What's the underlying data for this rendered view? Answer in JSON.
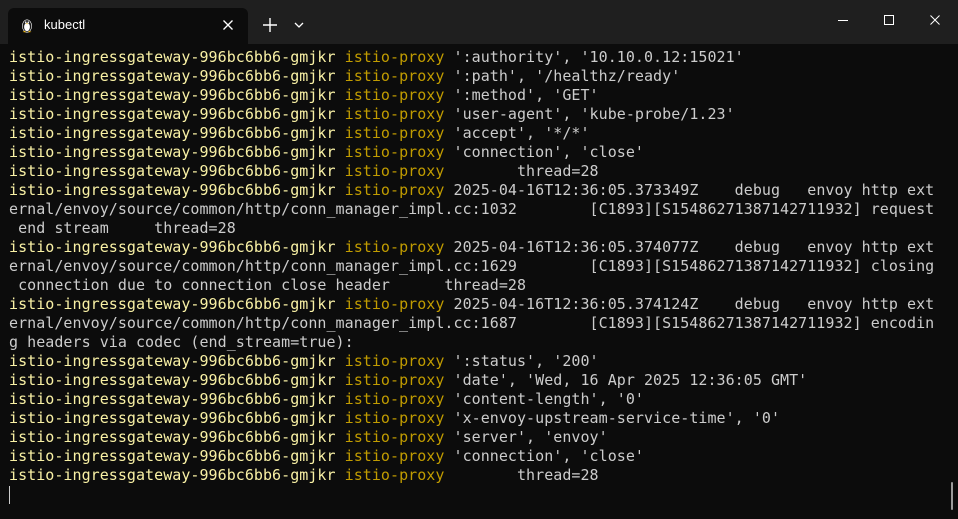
{
  "window": {
    "tab_title": "kubectl",
    "tab_icon": "linux-penguin-icon"
  },
  "colors": {
    "pod_name": "#f9f1a5",
    "container_name": "#c19c00",
    "message": "#cccccc",
    "background": "#0c0c0c",
    "titlebar": "#1f1f1f"
  },
  "terminal": {
    "lines": [
      {
        "pod": "istio-ingressgateway-996bc6bb6-gmjkr",
        "container": "istio-proxy",
        "msg": " ':authority', '10.10.0.12:15021'"
      },
      {
        "pod": "istio-ingressgateway-996bc6bb6-gmjkr",
        "container": "istio-proxy",
        "msg": " ':path', '/healthz/ready'"
      },
      {
        "pod": "istio-ingressgateway-996bc6bb6-gmjkr",
        "container": "istio-proxy",
        "msg": " ':method', 'GET'"
      },
      {
        "pod": "istio-ingressgateway-996bc6bb6-gmjkr",
        "container": "istio-proxy",
        "msg": " 'user-agent', 'kube-probe/1.23'"
      },
      {
        "pod": "istio-ingressgateway-996bc6bb6-gmjkr",
        "container": "istio-proxy",
        "msg": " 'accept', '*/*'"
      },
      {
        "pod": "istio-ingressgateway-996bc6bb6-gmjkr",
        "container": "istio-proxy",
        "msg": " 'connection', 'close'"
      },
      {
        "pod": "istio-ingressgateway-996bc6bb6-gmjkr",
        "container": "istio-proxy",
        "msg": "        thread=28"
      },
      {
        "pod": "istio-ingressgateway-996bc6bb6-gmjkr",
        "container": "istio-proxy",
        "msg": " 2025-04-16T12:36:05.373349Z    debug   envoy http ext"
      },
      {
        "pod": "",
        "container": "",
        "msg": "ernal/envoy/source/common/http/conn_manager_impl.cc:1032        [C1893][S15486271387142711932] request"
      },
      {
        "pod": "",
        "container": "",
        "msg": " end stream     thread=28"
      },
      {
        "pod": "istio-ingressgateway-996bc6bb6-gmjkr",
        "container": "istio-proxy",
        "msg": " 2025-04-16T12:36:05.374077Z    debug   envoy http ext"
      },
      {
        "pod": "",
        "container": "",
        "msg": "ernal/envoy/source/common/http/conn_manager_impl.cc:1629        [C1893][S15486271387142711932] closing"
      },
      {
        "pod": "",
        "container": "",
        "msg": " connection due to connection close header      thread=28"
      },
      {
        "pod": "istio-ingressgateway-996bc6bb6-gmjkr",
        "container": "istio-proxy",
        "msg": " 2025-04-16T12:36:05.374124Z    debug   envoy http ext"
      },
      {
        "pod": "",
        "container": "",
        "msg": "ernal/envoy/source/common/http/conn_manager_impl.cc:1687        [C1893][S15486271387142711932] encodin"
      },
      {
        "pod": "",
        "container": "",
        "msg": "g headers via codec (end_stream=true):"
      },
      {
        "pod": "istio-ingressgateway-996bc6bb6-gmjkr",
        "container": "istio-proxy",
        "msg": " ':status', '200'"
      },
      {
        "pod": "istio-ingressgateway-996bc6bb6-gmjkr",
        "container": "istio-proxy",
        "msg": " 'date', 'Wed, 16 Apr 2025 12:36:05 GMT'"
      },
      {
        "pod": "istio-ingressgateway-996bc6bb6-gmjkr",
        "container": "istio-proxy",
        "msg": " 'content-length', '0'"
      },
      {
        "pod": "istio-ingressgateway-996bc6bb6-gmjkr",
        "container": "istio-proxy",
        "msg": " 'x-envoy-upstream-service-time', '0'"
      },
      {
        "pod": "istio-ingressgateway-996bc6bb6-gmjkr",
        "container": "istio-proxy",
        "msg": " 'server', 'envoy'"
      },
      {
        "pod": "istio-ingressgateway-996bc6bb6-gmjkr",
        "container": "istio-proxy",
        "msg": " 'connection', 'close'"
      },
      {
        "pod": "istio-ingressgateway-996bc6bb6-gmjkr",
        "container": "istio-proxy",
        "msg": "        thread=28"
      }
    ]
  }
}
